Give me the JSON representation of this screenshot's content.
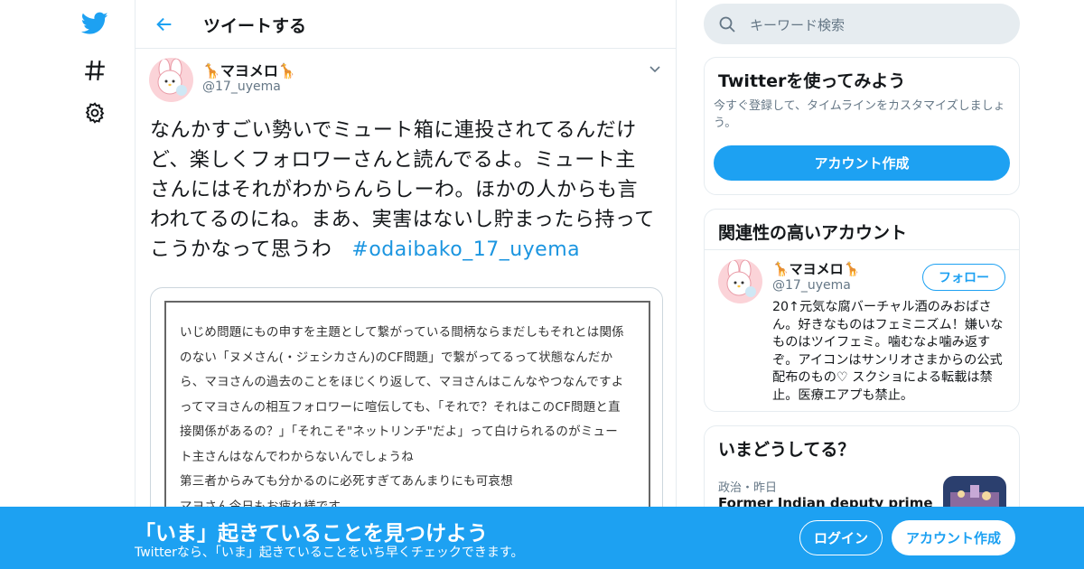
{
  "nav": {
    "icons": [
      "twitter-bird-icon",
      "explore-hash-icon",
      "settings-gear-icon"
    ]
  },
  "header": {
    "title": "ツイートする"
  },
  "tweet": {
    "display_name": "🦒マヨメロ🦒",
    "handle": "@17_uyema",
    "text": "なんかすごい勢いでミュート箱に連投されてるんだけど、楽しくフォロワーさんと読んでるよ。ミュート主さんにはそれがわからんらしーわ。ほかの人からも言われてるのにね。まあ、実害はないし貯まったら持ってこうかなって思うわ",
    "hashtag": "#odaibako_17_uyema",
    "image_lines": [
      "いじめ問題にもの申すを主題として繋がっている間柄ならまだしもそれとは関係",
      "のない「ヌメさん(・ジェシカさん)のCF問題」で繋がってるって状態なんだか",
      "ら、マヨさんの過去のことをほじくり返して、マヨさんはこんなやつなんですよ",
      "ってマヨさんの相互フォロワーに喧伝しても、「それで？それはこのCF問題と直",
      "接関係があるの？」「それこそ\"ネットリンチ\"だよ」って白けられるのがミュー",
      "ト主さんはなんでわからないんでしょうね",
      "第三者からみても分かるのに必死すぎてあんまりにも可哀想",
      "マヨさん今日もお疲れ様です"
    ]
  },
  "search": {
    "placeholder": "キーワード検索"
  },
  "signup_card": {
    "title": "Twitterを使ってみよう",
    "description": "今すぐ登録して、タイムラインをカスタマイズしましょう。",
    "button": "アカウント作成"
  },
  "related": {
    "title": "関連性の高いアカウント",
    "display_name": "🦒マヨメロ🦒",
    "handle": "@17_uyema",
    "follow_label": "フォロー",
    "bio": "20↑元気な腐バーチャル酒のみおばさん。好きなものはフェミニズム！嫌いなものはツイフェミ。噛むなよ噛み返すぞ。アイコンはサンリオさまからの公式配布のもの♡ スクショによる転載は禁止。医療エアプも禁止。"
  },
  "trends": {
    "title": "いまどうしてる？",
    "category": "政治・昨日",
    "headline": "Former Indian deputy prime"
  },
  "banner": {
    "title": "「いま」起きていることを見つけよう",
    "subtitle": "Twitterなら、「いま」起きていることをいち早くチェックできます。",
    "login": "ログイン",
    "signup": "アカウント作成"
  },
  "colors": {
    "brand_blue": "#1da1f2",
    "link_blue": "#1b95e0",
    "secondary_text": "#657786",
    "border": "#e6ecf0"
  }
}
